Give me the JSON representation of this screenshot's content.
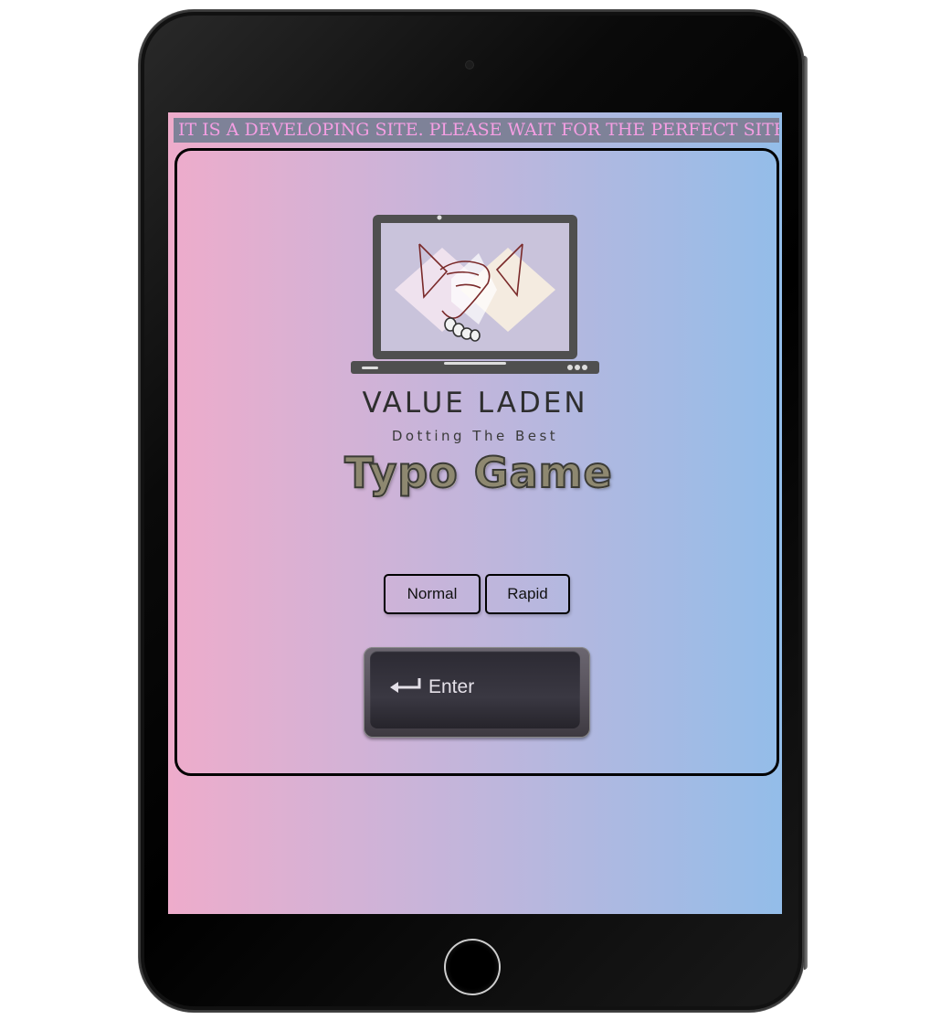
{
  "marquee": {
    "text": "C. IT IS A DEVELOPING SITE. PLEASE WAIT FOR THE PERFECT SITE.",
    "text_color": "#f59ee3",
    "bg_color": "#7e8298"
  },
  "logo": {
    "icon": "laptop-handshake-icon",
    "brand_name": "VALUE LADEN",
    "tagline": "Dotting The Best"
  },
  "game": {
    "title": "Typo Game"
  },
  "modes": {
    "normal_label": "Normal",
    "rapid_label": "Rapid"
  },
  "enter_key": {
    "icon": "return-arrow-icon",
    "label": "Enter"
  },
  "colors": {
    "gradient_start": "#eeaccb",
    "gradient_end": "#93bde9",
    "card_border": "#000000"
  }
}
